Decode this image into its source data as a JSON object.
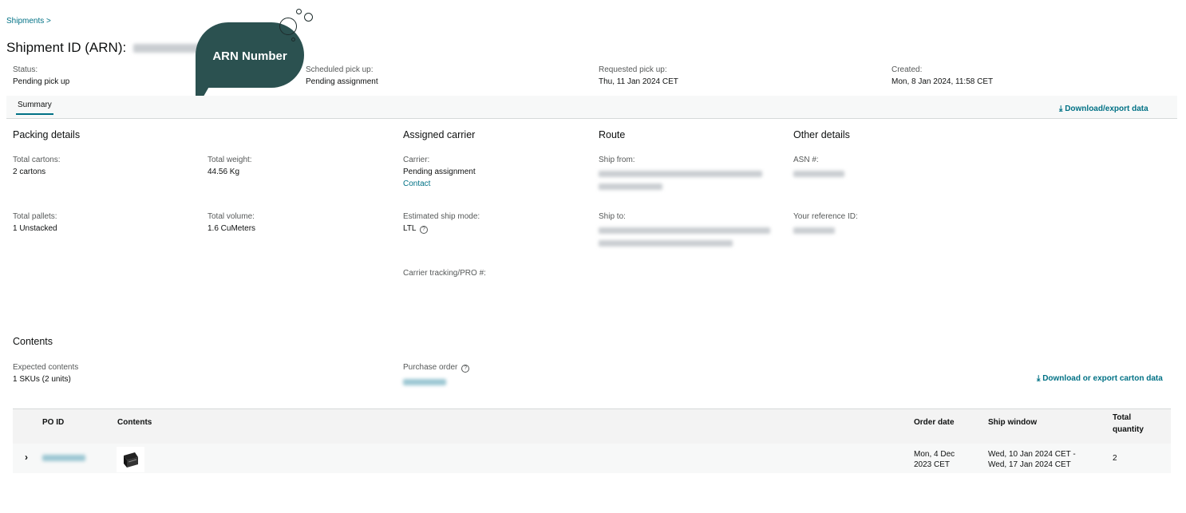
{
  "breadcrumb": "Shipments >",
  "title": "Shipment ID (ARN):",
  "annotation": "ARN Number",
  "summary_bar": [
    {
      "label": "Status:",
      "value": "Pending pick up"
    },
    {
      "label": "Scheduled pick up:",
      "value": "Pending assignment"
    },
    {
      "label": "Requested pick up:",
      "value": "Thu, 11 Jan 2024 CET"
    },
    {
      "label": "Created:",
      "value": "Mon, 8 Jan 2024, 11:58 CET"
    }
  ],
  "tabs": {
    "summary": "Summary"
  },
  "download_export": "Download/export data",
  "packing": {
    "heading": "Packing details",
    "total_cartons_label": "Total cartons:",
    "total_cartons": "2 cartons",
    "total_weight_label": "Total weight:",
    "total_weight": "44.56 Kg",
    "total_pallets_label": "Total pallets:",
    "total_pallets": "1 Unstacked",
    "total_volume_label": "Total volume:",
    "total_volume": "1.6 CuMeters"
  },
  "carrier": {
    "heading": "Assigned carrier",
    "carrier_label": "Carrier:",
    "carrier_value": "Pending assignment",
    "contact": "Contact",
    "ship_mode_label": "Estimated ship mode:",
    "ship_mode": "LTL",
    "tracking_label": "Carrier tracking/PRO #:"
  },
  "route": {
    "heading": "Route",
    "ship_from_label": "Ship from:",
    "ship_to_label": "Ship to:"
  },
  "other": {
    "heading": "Other details",
    "asn_label": "ASN #:",
    "ref_label": "Your reference ID:"
  },
  "contents": {
    "heading": "Contents",
    "expected_label": "Expected contents",
    "expected_value": "1 SKUs (2 units)",
    "po_label": "Purchase order",
    "download_carton": "Download or export carton data"
  },
  "table": {
    "headers": {
      "po_id": "PO ID",
      "contents": "Contents",
      "order_date": "Order date",
      "ship_window": "Ship window",
      "total_qty_1": "Total",
      "total_qty_2": "quantity"
    },
    "row": {
      "order_date_1": "Mon, 4 Dec",
      "order_date_2": "2023 CET",
      "ship_window_1": "Wed, 10 Jan 2024 CET -",
      "ship_window_2": "Wed, 17 Jan 2024 CET",
      "quantity": "2"
    }
  },
  "colors": {
    "accent": "#007185",
    "bubble": "#2b5150"
  }
}
